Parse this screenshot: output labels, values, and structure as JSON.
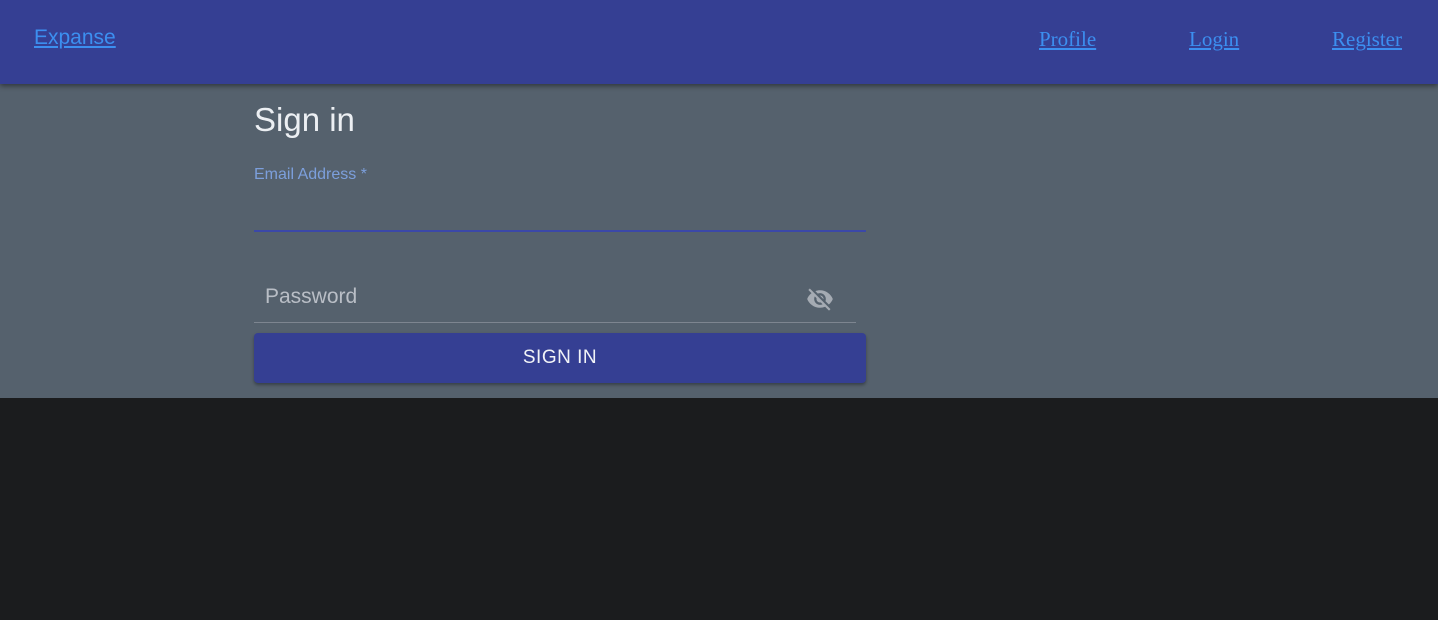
{
  "nav": {
    "brand": "Expanse",
    "links": [
      "Profile",
      "Login",
      "Register"
    ]
  },
  "signin": {
    "title": "Sign in",
    "email_label": "Email Address *",
    "email_value": "",
    "password_placeholder": "Password",
    "password_value": "",
    "visibility_icon": "visibility-off-icon",
    "submit_label": "SIGN IN"
  },
  "colors": {
    "app_bar": "#353f93",
    "link": "#3c8ff0",
    "panel": "#55616d",
    "page_background": "#1b1c1e",
    "email_label": "#7c9fdc",
    "button": "#353f93"
  }
}
